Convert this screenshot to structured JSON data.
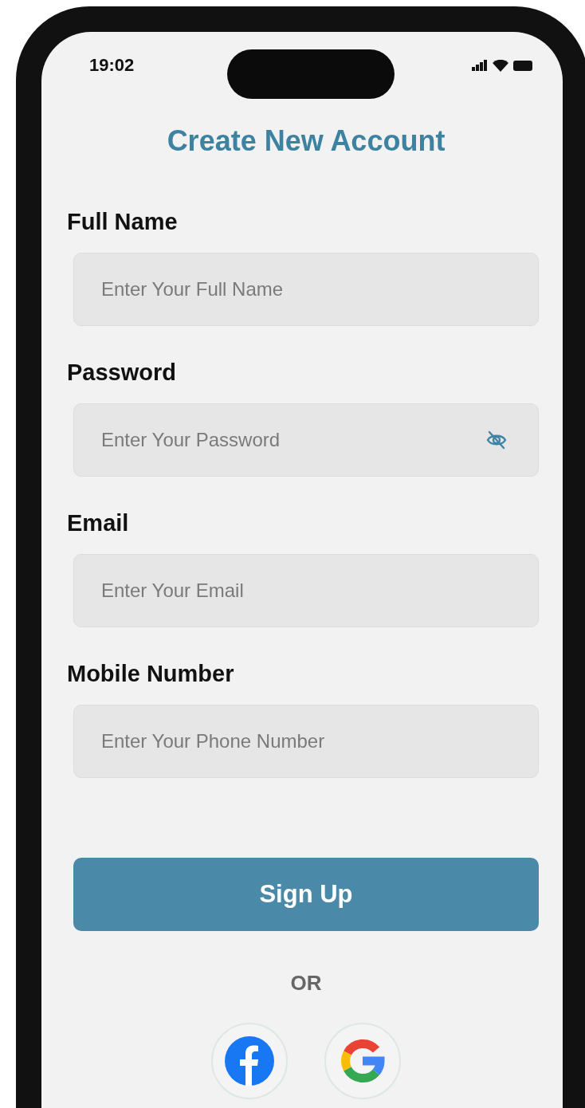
{
  "status_bar": {
    "time": "19:02"
  },
  "title": "Create New Account",
  "fields": [
    {
      "label": "Full Name",
      "placeholder": "Enter Your Full Name",
      "kind": "text"
    },
    {
      "label": "Password",
      "placeholder": "Enter Your Password",
      "kind": "password"
    },
    {
      "label": "Email",
      "placeholder": "Enter Your Email",
      "kind": "text"
    },
    {
      "label": "Mobile Number",
      "placeholder": "Enter Your Phone Number",
      "kind": "text"
    }
  ],
  "primary_button": "Sign Up",
  "divider_text": "OR",
  "social_buttons": [
    {
      "kind": "facebook"
    },
    {
      "kind": "google"
    }
  ]
}
